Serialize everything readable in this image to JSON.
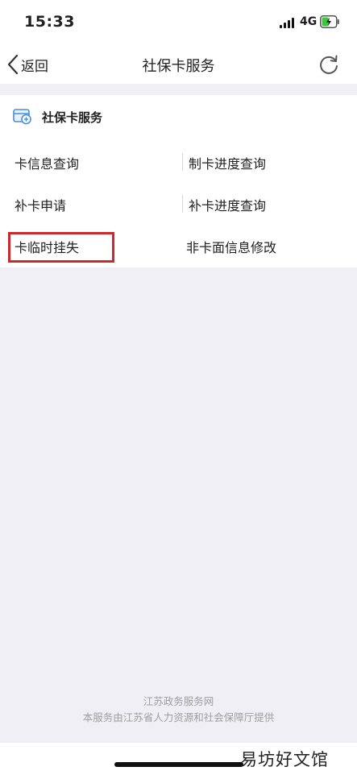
{
  "status_bar": {
    "time": "15:33",
    "network": "4G",
    "icons": [
      "signal-icon",
      "battery-charging-icon"
    ]
  },
  "nav": {
    "back_label": "返回",
    "title": "社保卡服务",
    "icons": [
      "chevron-left-icon",
      "refresh-icon"
    ]
  },
  "section": {
    "title": "社保卡服务",
    "icon": "social-security-card-icon",
    "accent_color": "#4a8fd8"
  },
  "services": [
    {
      "label": "卡信息查询"
    },
    {
      "label": "制卡进度查询"
    },
    {
      "label": "补卡申请"
    },
    {
      "label": "补卡进度查询"
    },
    {
      "label": "卡临时挂失",
      "highlighted": true
    },
    {
      "label": "非卡面信息修改"
    }
  ],
  "highlight_color": "#cc2a2a",
  "footer": {
    "line1": "江苏政务服务网",
    "line2": "本服务由江苏省人力资源和社会保障厅提供"
  },
  "watermark": "易坊好文馆"
}
